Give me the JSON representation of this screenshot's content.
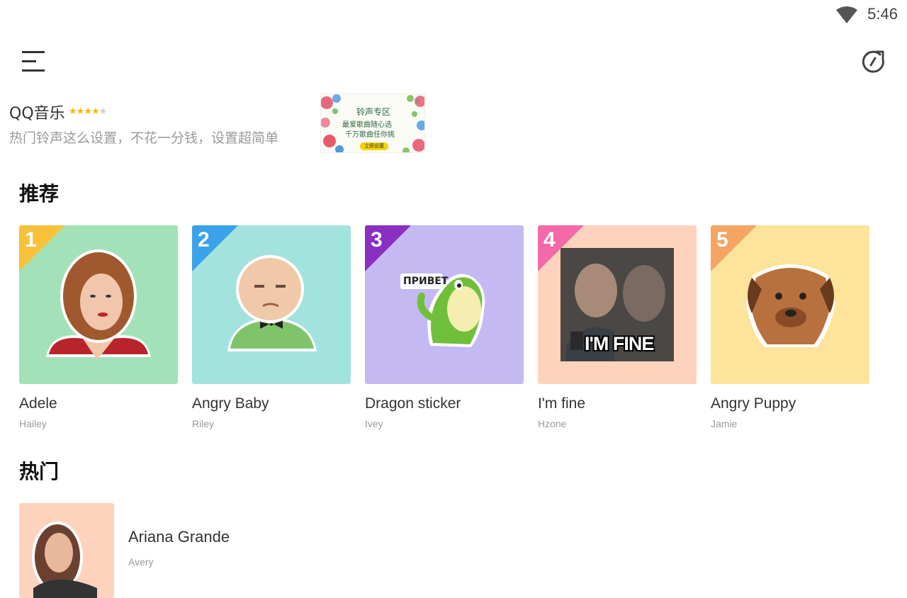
{
  "status_bar": {
    "time": "5:46",
    "icons": [
      "wifi-icon"
    ]
  },
  "toolbar": {
    "menu_icon": "menu-icon",
    "refresh_icon": "refresh-icon"
  },
  "ad": {
    "title": "QQ音乐",
    "rating": 4,
    "rating_max": 5,
    "description": "热门铃声这么设置，不花一分钱，设置超简单",
    "image_title": "铃声专区",
    "image_line1": "最爱歌曲随心选",
    "image_line2": "千万歌曲任你挑",
    "image_button": "立即设置"
  },
  "sections": {
    "recommended": "推荐",
    "hot": "热门"
  },
  "recommended": [
    {
      "rank": "1",
      "name": "Adele",
      "author": "Hailey",
      "bg": "#a3e2b8",
      "badge": "#f7c23a"
    },
    {
      "rank": "2",
      "name": "Angry Baby",
      "author": "Riley",
      "bg": "#a3e3dd",
      "badge": "#3aa2e8"
    },
    {
      "rank": "3",
      "name": "Dragon sticker",
      "author": "Ivey",
      "bg": "#c4b9f3",
      "badge": "#8a2fc2"
    },
    {
      "rank": "4",
      "name": "I'm fine",
      "author": "Hzone",
      "bg": "#fdd3bd",
      "badge": "#f46aa8"
    },
    {
      "rank": "5",
      "name": "Angry Puppy",
      "author": "Jamie",
      "bg": "#fde49a",
      "badge": "#f5a561"
    }
  ],
  "sticker_texts": {
    "dragon": "ПРИВЕТ",
    "fine": "I'M FINE"
  },
  "hot": [
    {
      "name": "Ariana Grande",
      "author": "Avery"
    }
  ]
}
